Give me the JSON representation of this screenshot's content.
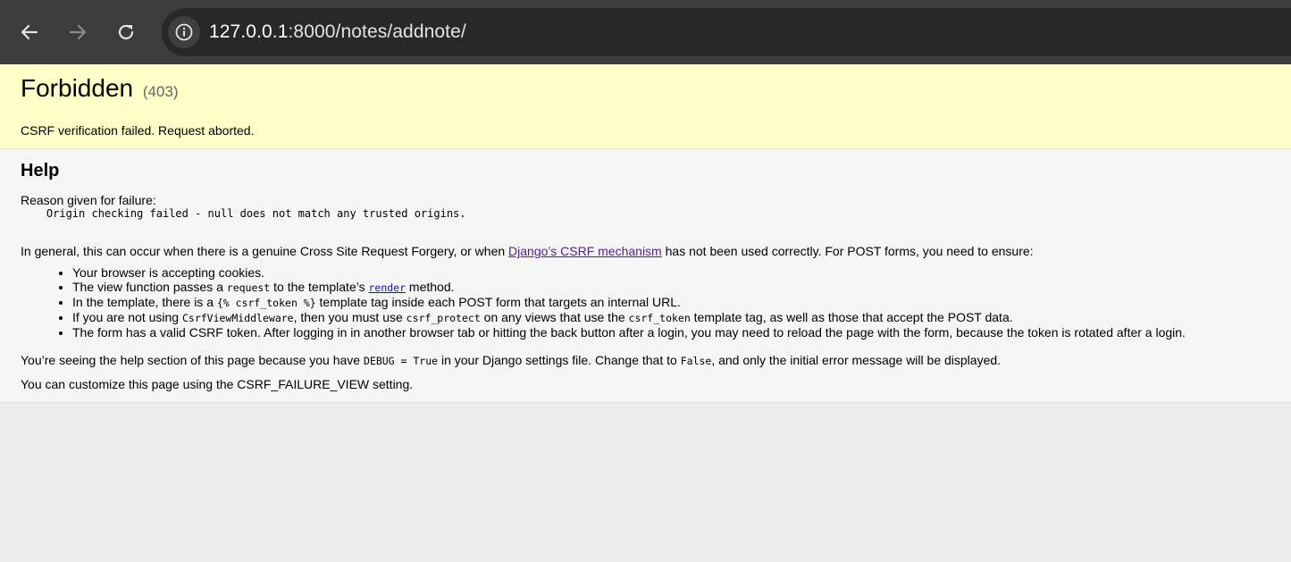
{
  "browser": {
    "url_host": "127.0.0.1",
    "url_rest": ":8000/notes/addnote/",
    "icons": [
      "back-arrow-icon",
      "forward-arrow-icon",
      "reload-icon",
      "info-icon"
    ]
  },
  "summary": {
    "title": "Forbidden",
    "status_code": "(403)",
    "message": "CSRF verification failed. Request aborted."
  },
  "help": {
    "heading": "Help",
    "reason_label": "Reason given for failure:",
    "reason_detail": "    Origin checking failed - null does not match any trusted origins.",
    "general_pre": "In general, this can occur when there is a genuine Cross Site Request Forgery, or when ",
    "general_link": "Django’s CSRF mechanism",
    "general_post": " has not been used correctly. For POST forms, you need to ensure:",
    "items": {
      "cookies": "Your browser is accepting cookies.",
      "view_pre": "The view function passes a ",
      "view_code": "request",
      "view_mid": " to the template’s ",
      "view_link": "render",
      "view_post": " method.",
      "template_pre": "In the template, there is a ",
      "template_code": "{% csrf_token %}",
      "template_post": " template tag inside each POST form that targets an internal URL.",
      "mw_pre": "If you are not using ",
      "mw_code1": "CsrfViewMiddleware",
      "mw_mid1": ", then you must use ",
      "mw_code2": "csrf_protect",
      "mw_mid2": " on any views that use the ",
      "mw_code3": "csrf_token",
      "mw_post": " template tag, as well as those that accept the POST data.",
      "token": "The form has a valid CSRF token. After logging in in another browser tab or hitting the back button after a login, you may need to reload the page with the form, because the token is rotated after a login."
    },
    "debug_pre": "You’re seeing the help section of this page because you have ",
    "debug_code1": "DEBUG = True",
    "debug_mid": " in your Django settings file. Change that to ",
    "debug_code2": "False",
    "debug_post": ", and only the initial error message will be displayed.",
    "customize": "You can customize this page using the CSRF_FAILURE_VIEW setting."
  }
}
